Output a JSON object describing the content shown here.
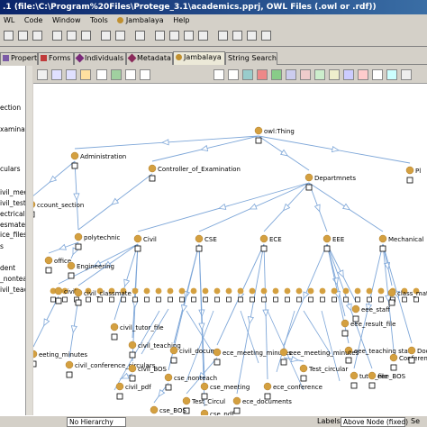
{
  "window": {
    "title": ".1   (file:\\C:\\Program%20Files\\Protege_3.1\\academics.pprj, OWL Files (.owl or .rdf))"
  },
  "menu": [
    "WL",
    "Code",
    "Window",
    "Tools",
    "Jambalaya",
    "Help"
  ],
  "tabs": [
    {
      "label": "Properties",
      "color": "#7b5aa6"
    },
    {
      "label": "Forms",
      "color": "#c03a3a"
    },
    {
      "label": "Individuals",
      "color": "#7a2a7a"
    },
    {
      "label": "Metadata",
      "color": "#8a2a5a"
    },
    {
      "label": "Jambalaya",
      "color": "#c09030"
    },
    {
      "label": "String Search",
      "color": ""
    }
  ],
  "selected_tab": "Jambalaya",
  "left_panel": {
    "items": [
      "ection",
      "xaminati",
      "",
      "culars",
      "ivil_meeting",
      "ivil_test_c",
      "ectricalsen",
      "esmaterials",
      "ice_files",
      "s",
      "dent",
      "_nontea",
      "ivil_teachi"
    ]
  },
  "graph": {
    "node_color": "#d4a040",
    "edge_color": "#7da6d8",
    "labels": [
      "owl:Thing",
      "Administration",
      "Controller_of_Examination",
      "Departmnets",
      "Pl",
      "ccount_section",
      "polytechnic",
      "Civil",
      "CSE",
      "ECE",
      "EEE",
      "Mechanical",
      "office",
      "Engineering",
      "civilc",
      "civil_classmate",
      "eee_staff",
      "class_mate",
      "civil_tutor_file",
      "civil_teaching",
      "eeting_minutes",
      "civil_docum",
      "civil_conference_circulars",
      "cse_nonteach",
      "civil_BOS",
      "eee_teaching staff",
      "Conference_circul",
      "eee_result_file",
      "tutor_file",
      "eee_BOS",
      "ece_meeting_minutes",
      "eee_meeting_minutes",
      "Test_circular",
      "Docum",
      "civil_pdf",
      "cse_meeting",
      "ece_conference",
      "Test_Circul",
      "cse_BOS",
      "ece_documents",
      "cse_pdf"
    ]
  },
  "status": {
    "hierarchy": "No Hierarchy",
    "labels_label": "Labels:",
    "labels_value": "Above Node (fixed)",
    "arrange": "Se"
  }
}
